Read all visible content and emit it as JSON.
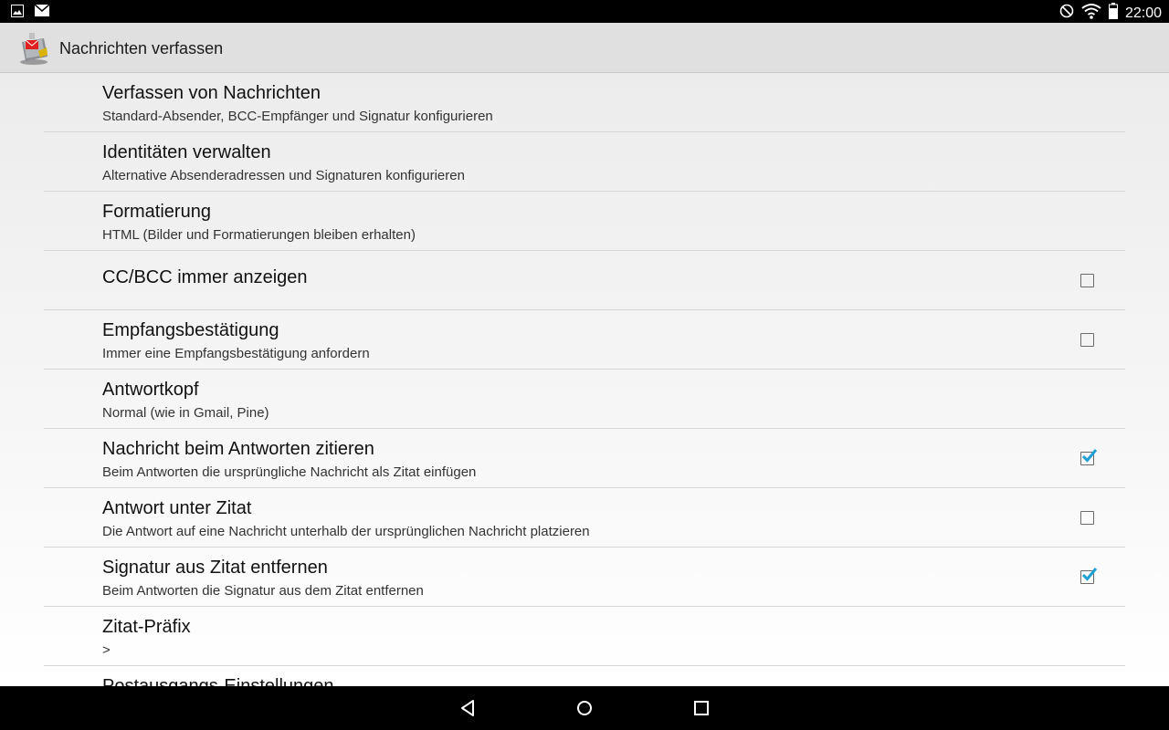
{
  "status_bar": {
    "left_icons": [
      "image-notification-icon",
      "mail-notification-icon"
    ],
    "right_icons": [
      "do-not-disturb-icon",
      "wifi-icon",
      "battery-icon"
    ],
    "time": "22:00"
  },
  "action_bar": {
    "title": "Nachrichten verfassen",
    "icon": "app-logo-icon"
  },
  "preferences": [
    {
      "title": "Verfassen von Nachrichten",
      "summary": "Standard-Absender, BCC-Empfänger und Signatur konfigurieren"
    },
    {
      "title": "Identitäten verwalten",
      "summary": "Alternative Absenderadressen und Signaturen konfigurieren"
    },
    {
      "title": "Formatierung",
      "summary": "HTML (Bilder und Formatierungen bleiben erhalten)"
    },
    {
      "title": "CC/BCC immer anzeigen",
      "summary": "",
      "checked": false
    },
    {
      "title": "Empfangsbestätigung",
      "summary": "Immer eine Empfangsbestätigung anfordern",
      "checked": false
    },
    {
      "title": "Antwortkopf",
      "summary": "Normal (wie in Gmail, Pine)"
    },
    {
      "title": "Nachricht beim Antworten zitieren",
      "summary": "Beim Antworten die ursprüngliche Nachricht als Zitat einfügen",
      "checked": true
    },
    {
      "title": "Antwort unter Zitat",
      "summary": "Die Antwort auf eine Nachricht unterhalb der ursprünglichen Nachricht platzieren",
      "checked": false
    },
    {
      "title": "Signatur aus Zitat entfernen",
      "summary": "Beim Antworten die Signatur aus dem Zitat entfernen",
      "checked": true
    },
    {
      "title": "Zitat-Präfix",
      "summary": ">"
    },
    {
      "title": "Postausgangs-Einstellungen",
      "summary": ""
    }
  ],
  "nav_bar": {
    "buttons": [
      "back-icon",
      "home-icon",
      "recents-icon"
    ]
  },
  "colors": {
    "checkbox_checked": "#1ea0d7",
    "background": "#ececec",
    "action_bar": "#e0e0e0"
  }
}
